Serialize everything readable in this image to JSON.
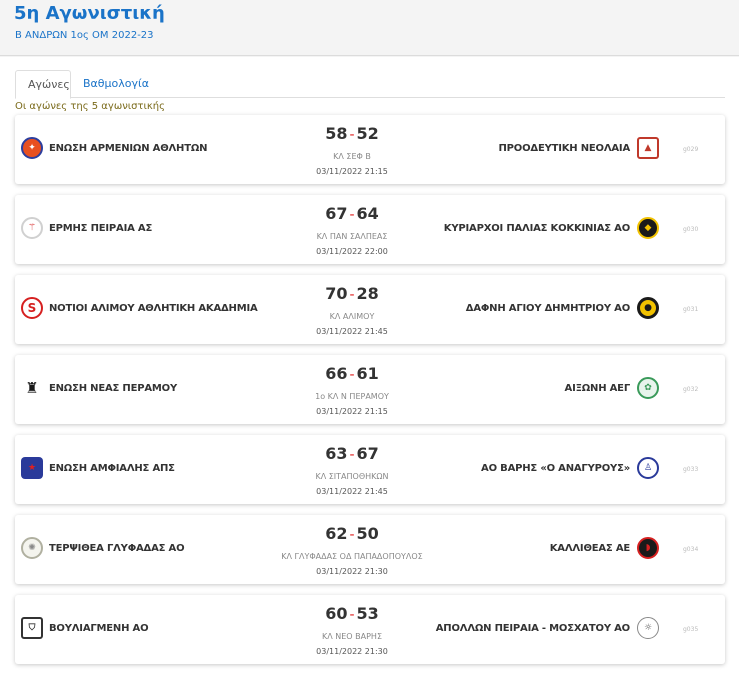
{
  "header": {
    "title": "5η Αγωνιστική",
    "subtitle": "Β ΑΝΔΡΩΝ 1ος ΟΜ 2022-23"
  },
  "tabs": [
    {
      "label": "Αγώνες"
    },
    {
      "label": "Βαθμολογία"
    }
  ],
  "caption": "Οι αγώνες της 5 αγωνιστικής",
  "matches": [
    {
      "home": "ΕΝΩΣΗ ΑΡΜΕΝΙΩΝ ΑΘΛΗΤΩΝ",
      "away": "ΠΡΟΟΔΕΥΤΙΚΗ ΝΕΟΛΑΙΑ",
      "home_score": "58",
      "away_score": "52",
      "sep": "-",
      "venue": "ΚΛ ΣΕΦ Β",
      "datetime": "03/11/2022 21:15",
      "code": "g029"
    },
    {
      "home": "ΕΡΜΗΣ ΠΕΙΡΑΙΑ ΑΣ",
      "away": "ΚΥΡΙΑΡΧΟΙ ΠΑΛΙΑΣ ΚΟΚΚΙΝΙΑΣ ΑΟ",
      "home_score": "67",
      "away_score": "64",
      "sep": "-",
      "venue": "ΚΛ ΠΑΝ ΣΑΛΠΕΑΣ",
      "datetime": "03/11/2022 22:00",
      "code": "g030"
    },
    {
      "home": "ΝΟΤΙΟΙ ΑΛΙΜΟΥ ΑΘΛΗΤΙΚΗ ΑΚΑΔΗΜΙΑ",
      "away": "ΔΑΦΝΗ ΑΓΙΟΥ ΔΗΜΗΤΡΙΟΥ ΑΟ",
      "home_score": "70",
      "away_score": "28",
      "sep": "-",
      "venue": "ΚΛ ΑΛΙΜΟΥ",
      "datetime": "03/11/2022 21:45",
      "code": "g031"
    },
    {
      "home": "ΕΝΩΣΗ ΝΕΑΣ ΠΕΡΑΜΟΥ",
      "away": "ΑΙΞΩΝΗ ΑΕΓ",
      "home_score": "66",
      "away_score": "61",
      "sep": "-",
      "venue": "1ο ΚΛ Ν ΠΕΡΑΜΟΥ",
      "datetime": "03/11/2022 21:15",
      "code": "g032"
    },
    {
      "home": "ΕΝΩΣΗ ΑΜΦΙΑΛΗΣ ΑΠΣ",
      "away": "ΑΟ ΒΑΡΗΣ «Ο ΑΝΑΓΥΡΟΥΣ»",
      "home_score": "63",
      "away_score": "67",
      "sep": "-",
      "venue": "ΚΛ ΣΙΤΑΠΟΘΗΚΩΝ",
      "datetime": "03/11/2022 21:45",
      "code": "g033"
    },
    {
      "home": "ΤΕΡΨΙΘΕΑ ΓΛΥΦΑΔΑΣ ΑΟ",
      "away": "ΚΑΛΛΙΘΕΑΣ ΑΕ",
      "home_score": "62",
      "away_score": "50",
      "sep": "-",
      "venue": "ΚΛ ΓΛΥΦΑΔΑΣ ΟΔ ΠΑΠΑΔΟΠΟΥΛΟΣ",
      "datetime": "03/11/2022 21:30",
      "code": "g034"
    },
    {
      "home": "ΒΟΥΛΙΑΓΜΕΝΗ ΑΟ",
      "away": "ΑΠΟΛΛΩΝ ΠΕΙΡΑΙΑ - ΜΟΣΧΑΤΟΥ ΑΟ",
      "home_score": "60",
      "away_score": "53",
      "sep": "-",
      "venue": "ΚΛ ΝΕΟ ΒΑΡΗΣ",
      "datetime": "03/11/2022 21:30",
      "code": "g035"
    }
  ]
}
